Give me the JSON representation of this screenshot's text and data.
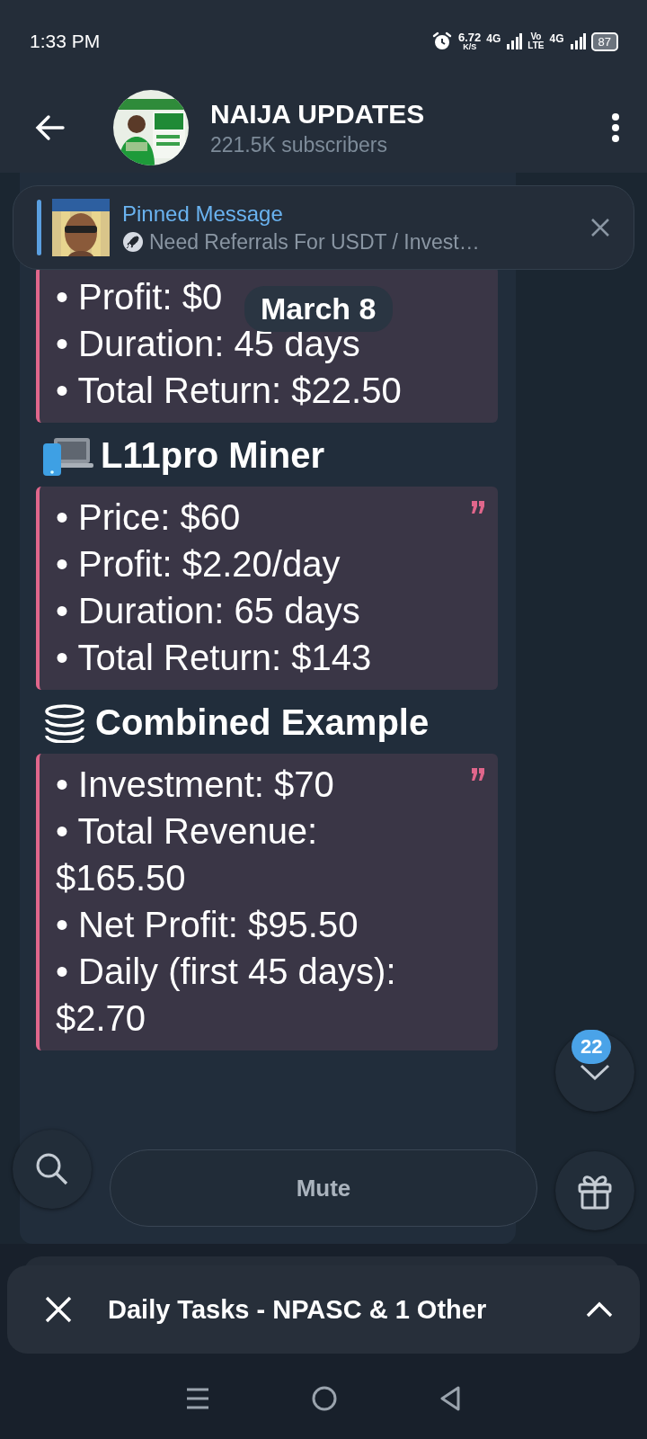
{
  "status_bar": {
    "time": "1:33 PM",
    "net_speed": "6.72",
    "net_speed_unit": "K/S",
    "sim1_network": "4G",
    "volte_top": "Vo",
    "volte_bottom": "LTE",
    "sim2_network": "4G",
    "battery": "87"
  },
  "header": {
    "title": "NAIJA UPDATES",
    "subtitle": "221.5K subscribers"
  },
  "pinned": {
    "label": "Pinned Message",
    "text": "Need Referrals For USDT / Invest…"
  },
  "date_chip": "March 8",
  "message": {
    "sections": [
      {
        "quote_mark": false,
        "lines": [
          "• Profit: $0",
          "• Duration: 45 days",
          "• Total Return: $22.50"
        ]
      },
      {
        "kind": "devices",
        "heading": "L11pro Miner",
        "quote_mark": true,
        "lines": [
          "• Price: $60",
          "• Profit: $2.20/day",
          "• Duration: 65 days",
          "• Total Return: $143"
        ]
      },
      {
        "kind": "coins",
        "heading": "Combined Example",
        "quote_mark": true,
        "lines": [
          "• Investment: $70",
          "• Total Revenue: $165.50",
          "• Net Profit: $95.50",
          "• Daily (first 45 days): $2.70"
        ]
      }
    ]
  },
  "scroll_button": {
    "badge": "22"
  },
  "input_bar": {
    "mute": "Mute"
  },
  "bottom_panel": {
    "title": "Daily Tasks - NPASC & 1 Other"
  }
}
